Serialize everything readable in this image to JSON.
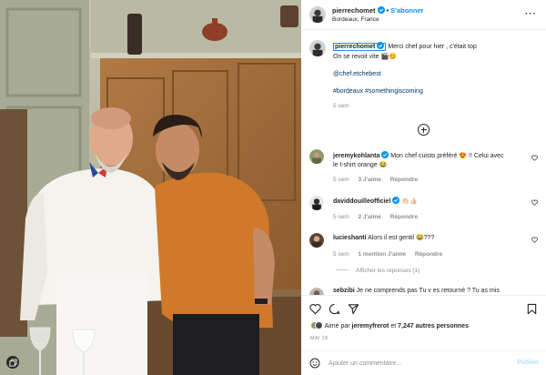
{
  "post": {
    "author": "pierrechomet",
    "follow_label": "S'abonner",
    "location": "Bordeaux, France",
    "caption_line1": "Merci chef pour hier , c'était top",
    "caption_line2": "On se revoit vite 🎬😊",
    "mention": "@chef.etchebest",
    "hashtags": "#bordeaux #somethingiscoming",
    "caption_time": "5 sem"
  },
  "comments": [
    {
      "user": "jeremykohlanta",
      "text_line1": " Mon chef cuisto préféré 😍 !! Celui avec",
      "text_line2": "le t-shirt orange 😂",
      "time": "5 sem",
      "likes": "3 J'aime",
      "reply": "Répondre"
    },
    {
      "user": "daviddouilleofficiel",
      "text_line1": " 👏🏻👍🏻",
      "time": "5 sem",
      "likes": "2 J'aime",
      "reply": "Répondre"
    },
    {
      "user": "lucieshanti",
      "text_line1": " Alors il est gentil 😂???",
      "time": "5 sem",
      "mention": "1 mention J'aime",
      "reply": "Répondre",
      "replies_toggle": "Afficher les réponses (1)"
    },
    {
      "user": "sebzibi",
      "text_line1": " Je ne comprends pas  Tu v es retourné ? Tu as mis"
    }
  ],
  "actions": {
    "liked_by_prefix": "Aimé par",
    "liked_by_user": "jeremyfrerot",
    "liked_by_conj": "et",
    "liked_by_count": "7,247 autres personnes",
    "date": "MAI 19"
  },
  "composer": {
    "placeholder": "Ajouter un commentaire...",
    "publish_label": "Publier"
  },
  "colors": {
    "accent": "#0095f6",
    "link": "#00376b",
    "muted": "#8e8e8e",
    "publish_disabled": "#b2dffc"
  },
  "icons": [
    "more-icon",
    "verified-icon",
    "add-circle-icon",
    "heart-icon",
    "comment-icon",
    "share-icon",
    "bookmark-icon",
    "emoji-icon",
    "multi-photo-icon"
  ]
}
